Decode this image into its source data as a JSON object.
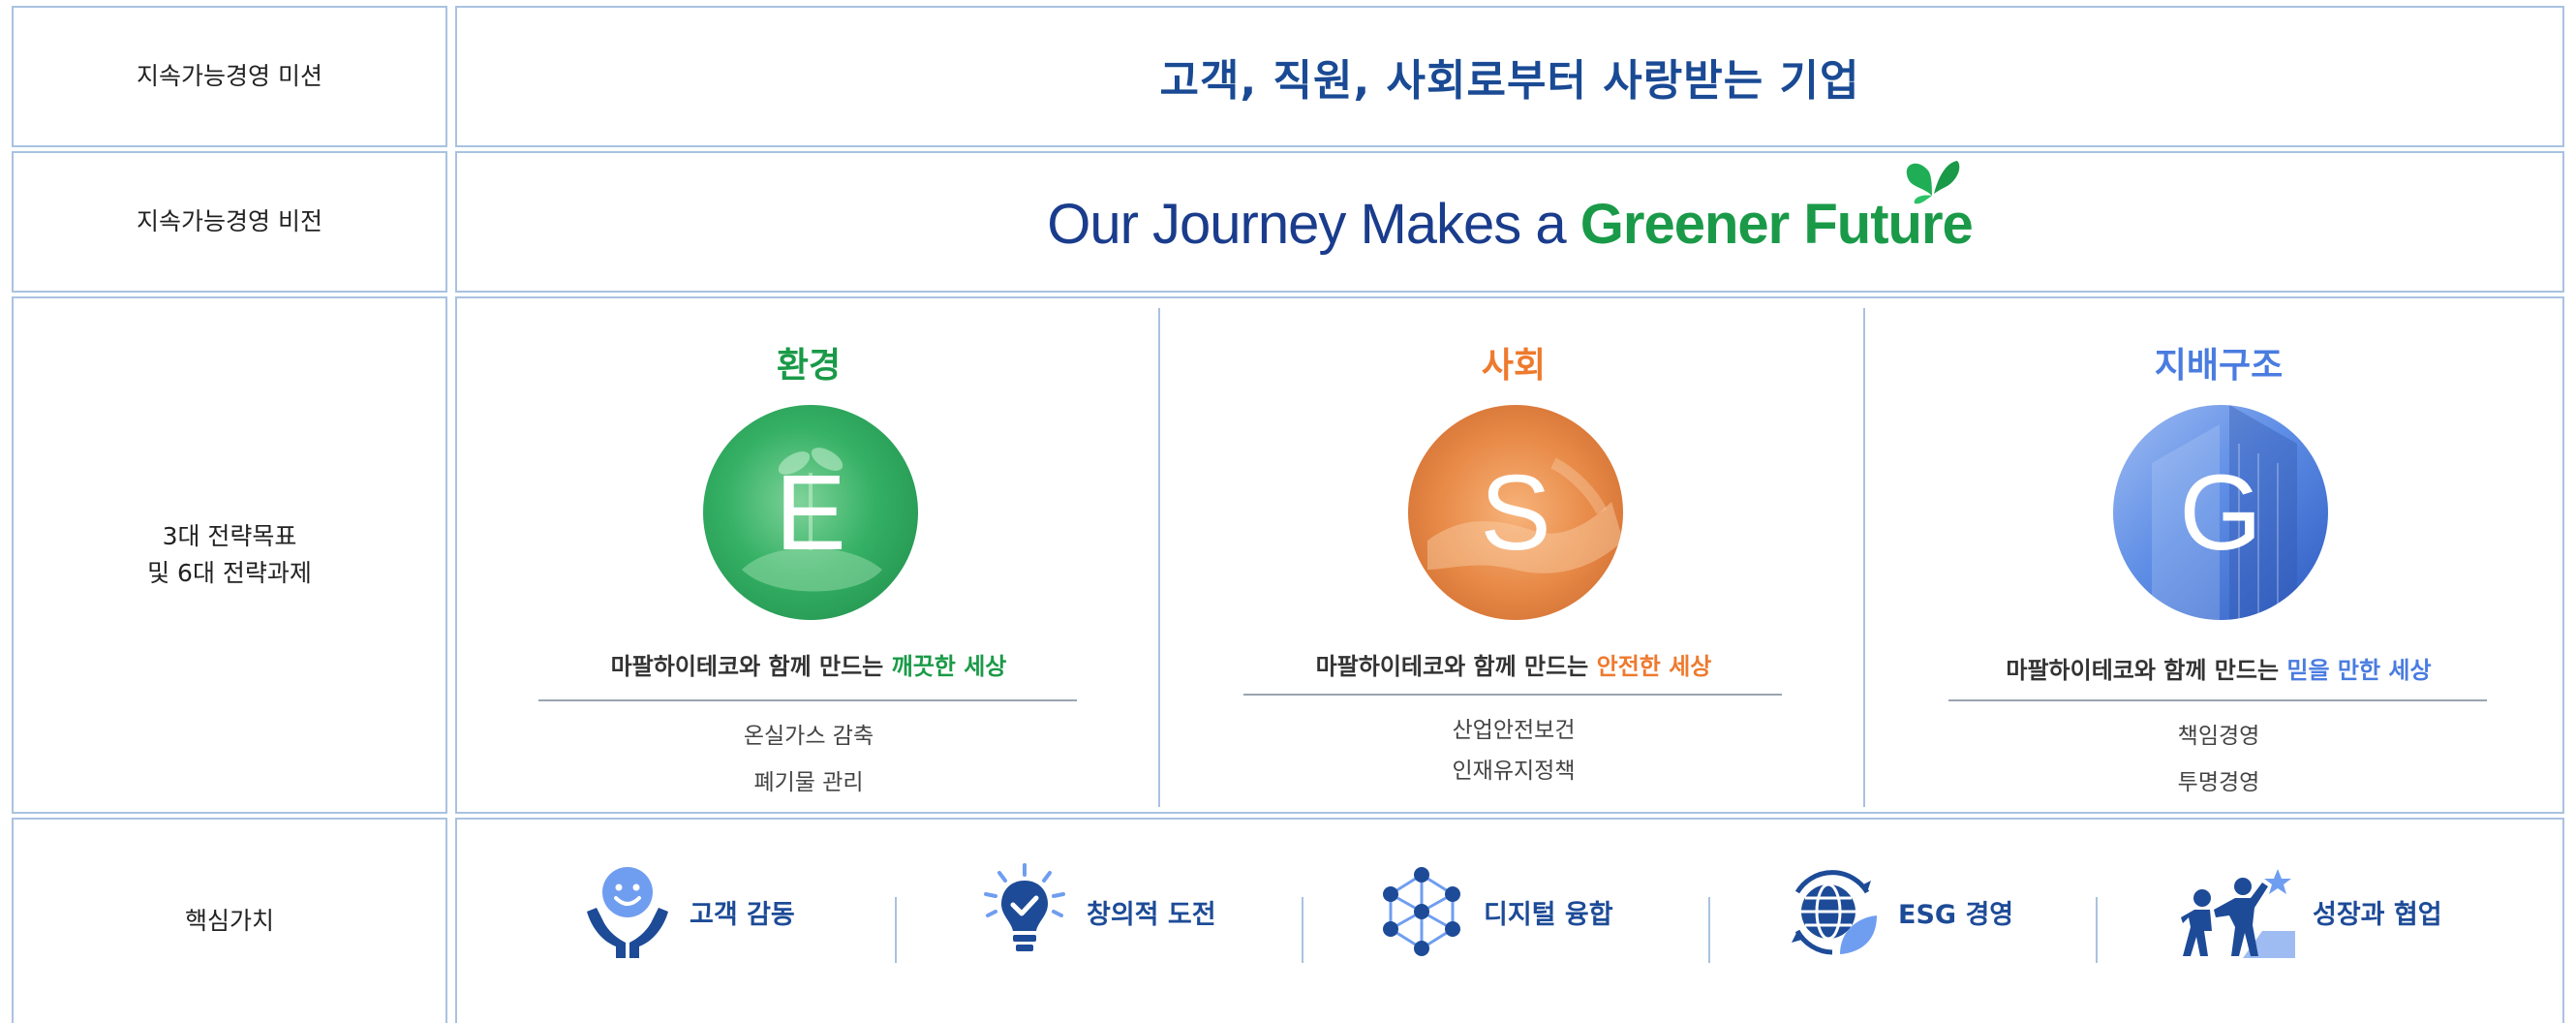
{
  "mission": {
    "label": "지속가능경영 미션",
    "text": "고객, 직원, 사회로부터 사랑받는 기업"
  },
  "vision": {
    "label": "지속가능경영 비전",
    "text_main": "Our Journey Makes a ",
    "text_green": "Greener Future",
    "icon": "butterfly-icon"
  },
  "goals": {
    "label_line1": "3대 전략목표",
    "label_line2": "및 6대 전략과제",
    "pillars": [
      {
        "title": "환경",
        "letter": "E",
        "color": "#1a9a48",
        "desc_prefix": "마팔하이테코와 함께 만드는 ",
        "desc_highlight": "깨끗한 세상",
        "tasks": [
          "온실가스 감축",
          "폐기물 관리"
        ]
      },
      {
        "title": "사회",
        "letter": "S",
        "color": "#ee7a2e",
        "desc_prefix": "마팔하이테코와 함께 만드는 ",
        "desc_highlight": "안전한 세상",
        "tasks": [
          "산업안전보건",
          "인재유지정책"
        ]
      },
      {
        "title": "지배구조",
        "letter": "G",
        "color": "#4a7ce0",
        "desc_prefix": "마팔하이테코와 함께 만드는 ",
        "desc_highlight": "믿을 만한 세상",
        "tasks": [
          "책임경영",
          "투명경영"
        ]
      }
    ]
  },
  "values": {
    "label": "핵심가치",
    "items": [
      {
        "label": "고객 감동",
        "icon": "smiley-hands-icon"
      },
      {
        "label": "창의적 도전",
        "icon": "lightbulb-check-icon"
      },
      {
        "label": "디지털 융합",
        "icon": "network-nodes-icon"
      },
      {
        "label": "ESG 경영",
        "icon": "globe-leaf-icon"
      },
      {
        "label": "성장과 협업",
        "icon": "climbing-people-icon"
      }
    ]
  },
  "colors": {
    "navy": "#1a4a94",
    "border": "#a9c2e0",
    "green": "#1a9a48",
    "orange": "#ee7a2e",
    "blue": "#4a7ce0"
  }
}
